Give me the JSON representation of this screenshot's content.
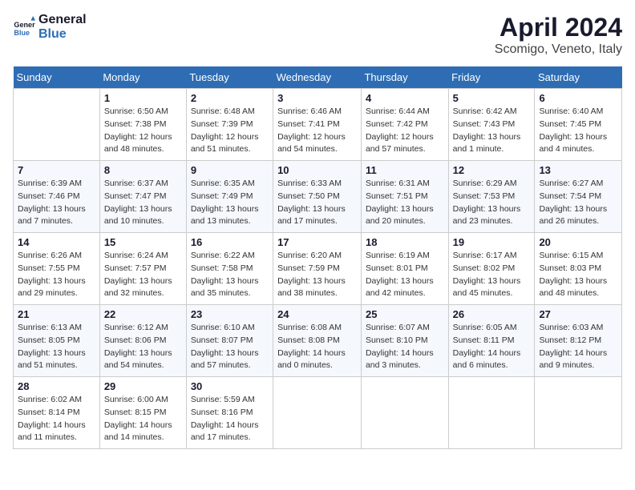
{
  "header": {
    "logo_line1": "General",
    "logo_line2": "Blue",
    "month": "April 2024",
    "location": "Scomigo, Veneto, Italy"
  },
  "weekdays": [
    "Sunday",
    "Monday",
    "Tuesday",
    "Wednesday",
    "Thursday",
    "Friday",
    "Saturday"
  ],
  "weeks": [
    [
      {
        "day": "",
        "info": ""
      },
      {
        "day": "1",
        "info": "Sunrise: 6:50 AM\nSunset: 7:38 PM\nDaylight: 12 hours\nand 48 minutes."
      },
      {
        "day": "2",
        "info": "Sunrise: 6:48 AM\nSunset: 7:39 PM\nDaylight: 12 hours\nand 51 minutes."
      },
      {
        "day": "3",
        "info": "Sunrise: 6:46 AM\nSunset: 7:41 PM\nDaylight: 12 hours\nand 54 minutes."
      },
      {
        "day": "4",
        "info": "Sunrise: 6:44 AM\nSunset: 7:42 PM\nDaylight: 12 hours\nand 57 minutes."
      },
      {
        "day": "5",
        "info": "Sunrise: 6:42 AM\nSunset: 7:43 PM\nDaylight: 13 hours\nand 1 minute."
      },
      {
        "day": "6",
        "info": "Sunrise: 6:40 AM\nSunset: 7:45 PM\nDaylight: 13 hours\nand 4 minutes."
      }
    ],
    [
      {
        "day": "7",
        "info": "Sunrise: 6:39 AM\nSunset: 7:46 PM\nDaylight: 13 hours\nand 7 minutes."
      },
      {
        "day": "8",
        "info": "Sunrise: 6:37 AM\nSunset: 7:47 PM\nDaylight: 13 hours\nand 10 minutes."
      },
      {
        "day": "9",
        "info": "Sunrise: 6:35 AM\nSunset: 7:49 PM\nDaylight: 13 hours\nand 13 minutes."
      },
      {
        "day": "10",
        "info": "Sunrise: 6:33 AM\nSunset: 7:50 PM\nDaylight: 13 hours\nand 17 minutes."
      },
      {
        "day": "11",
        "info": "Sunrise: 6:31 AM\nSunset: 7:51 PM\nDaylight: 13 hours\nand 20 minutes."
      },
      {
        "day": "12",
        "info": "Sunrise: 6:29 AM\nSunset: 7:53 PM\nDaylight: 13 hours\nand 23 minutes."
      },
      {
        "day": "13",
        "info": "Sunrise: 6:27 AM\nSunset: 7:54 PM\nDaylight: 13 hours\nand 26 minutes."
      }
    ],
    [
      {
        "day": "14",
        "info": "Sunrise: 6:26 AM\nSunset: 7:55 PM\nDaylight: 13 hours\nand 29 minutes."
      },
      {
        "day": "15",
        "info": "Sunrise: 6:24 AM\nSunset: 7:57 PM\nDaylight: 13 hours\nand 32 minutes."
      },
      {
        "day": "16",
        "info": "Sunrise: 6:22 AM\nSunset: 7:58 PM\nDaylight: 13 hours\nand 35 minutes."
      },
      {
        "day": "17",
        "info": "Sunrise: 6:20 AM\nSunset: 7:59 PM\nDaylight: 13 hours\nand 38 minutes."
      },
      {
        "day": "18",
        "info": "Sunrise: 6:19 AM\nSunset: 8:01 PM\nDaylight: 13 hours\nand 42 minutes."
      },
      {
        "day": "19",
        "info": "Sunrise: 6:17 AM\nSunset: 8:02 PM\nDaylight: 13 hours\nand 45 minutes."
      },
      {
        "day": "20",
        "info": "Sunrise: 6:15 AM\nSunset: 8:03 PM\nDaylight: 13 hours\nand 48 minutes."
      }
    ],
    [
      {
        "day": "21",
        "info": "Sunrise: 6:13 AM\nSunset: 8:05 PM\nDaylight: 13 hours\nand 51 minutes."
      },
      {
        "day": "22",
        "info": "Sunrise: 6:12 AM\nSunset: 8:06 PM\nDaylight: 13 hours\nand 54 minutes."
      },
      {
        "day": "23",
        "info": "Sunrise: 6:10 AM\nSunset: 8:07 PM\nDaylight: 13 hours\nand 57 minutes."
      },
      {
        "day": "24",
        "info": "Sunrise: 6:08 AM\nSunset: 8:08 PM\nDaylight: 14 hours\nand 0 minutes."
      },
      {
        "day": "25",
        "info": "Sunrise: 6:07 AM\nSunset: 8:10 PM\nDaylight: 14 hours\nand 3 minutes."
      },
      {
        "day": "26",
        "info": "Sunrise: 6:05 AM\nSunset: 8:11 PM\nDaylight: 14 hours\nand 6 minutes."
      },
      {
        "day": "27",
        "info": "Sunrise: 6:03 AM\nSunset: 8:12 PM\nDaylight: 14 hours\nand 9 minutes."
      }
    ],
    [
      {
        "day": "28",
        "info": "Sunrise: 6:02 AM\nSunset: 8:14 PM\nDaylight: 14 hours\nand 11 minutes."
      },
      {
        "day": "29",
        "info": "Sunrise: 6:00 AM\nSunset: 8:15 PM\nDaylight: 14 hours\nand 14 minutes."
      },
      {
        "day": "30",
        "info": "Sunrise: 5:59 AM\nSunset: 8:16 PM\nDaylight: 14 hours\nand 17 minutes."
      },
      {
        "day": "",
        "info": ""
      },
      {
        "day": "",
        "info": ""
      },
      {
        "day": "",
        "info": ""
      },
      {
        "day": "",
        "info": ""
      }
    ]
  ]
}
